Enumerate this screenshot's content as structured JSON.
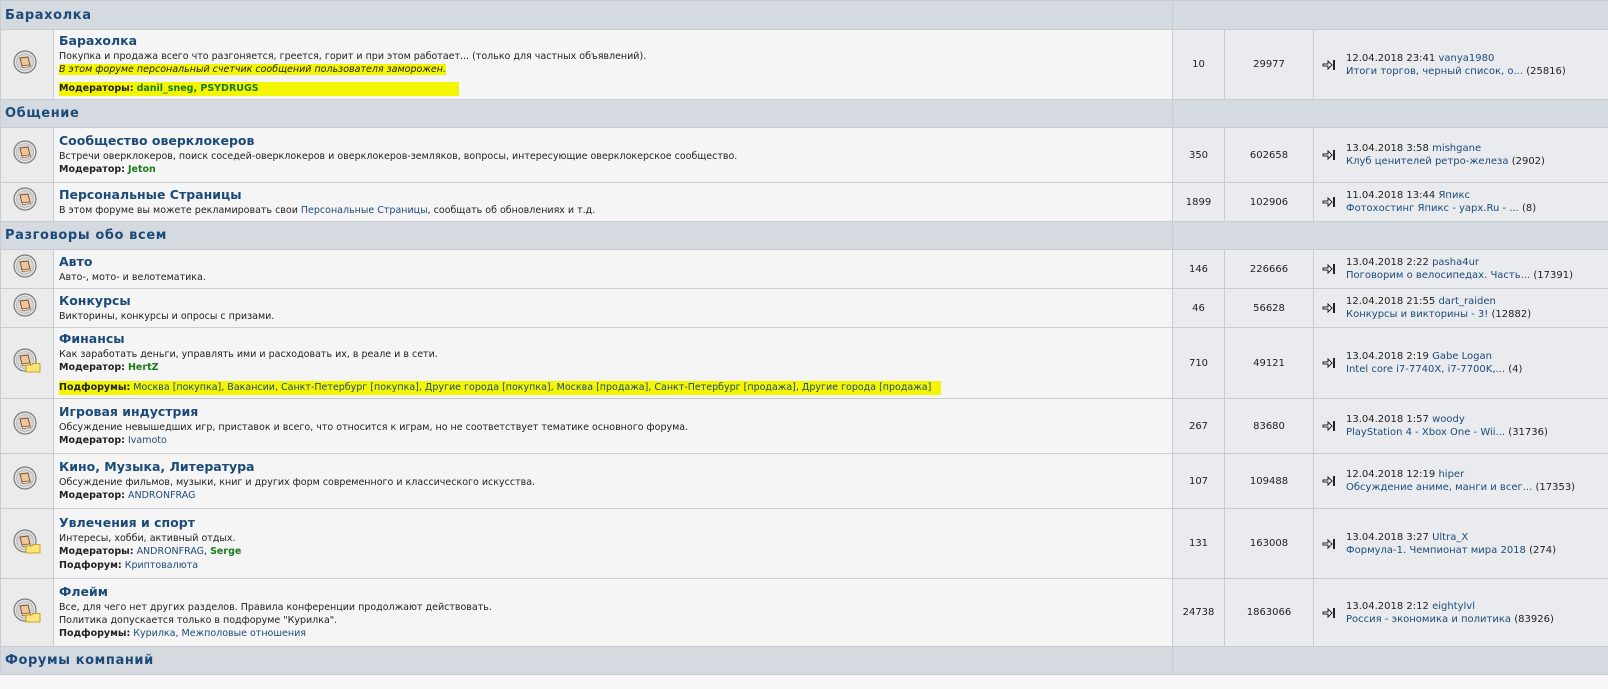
{
  "categories": [
    {
      "title": "Барахолка",
      "forums": [
        {
          "name": "Барахолка",
          "desc": "Покупка и продажа всего что разгоняется, греется, горит и при этом работает... (только для частных объявлений).",
          "note": "В этом форуме персональный счетчик сообщений пользователя заморожен.",
          "moderators_label": "Модераторы:",
          "moderators": "danil_sneg, PSYDRUGS",
          "topics": "10",
          "posts": "29977",
          "last_date": "12.04.2018 23:41",
          "last_user": "vanya1980",
          "last_title": "Итоги торгов, черный список, о...",
          "last_count": "(25816)"
        }
      ]
    },
    {
      "title": "Общение",
      "forums": [
        {
          "name": "Сообщество оверклокеров",
          "desc": "Встречи оверклокеров, поиск соседей-оверклокеров и оверклокеров-земляков, вопросы, интересующие оверклокерское сообщество.",
          "moderators_label": "Модератор:",
          "moderators": "Jeton",
          "topics": "350",
          "posts": "602658",
          "last_date": "13.04.2018 3:58",
          "last_user": "mishgane",
          "last_title": "Клуб ценителей ретро-железа",
          "last_count": "(2902)"
        },
        {
          "name": "Персональные Страницы",
          "desc_a": "В этом форуме вы можете рекламировать свои ",
          "desc_link": "Персональные Страницы",
          "desc_b": ", сообщать об обновлениях и т.д.",
          "topics": "1899",
          "posts": "102906",
          "last_date": "11.04.2018 13:44",
          "last_user": "Япикс",
          "last_title": "Фотохостинг Япикс - yapx.Ru - ...",
          "last_count": "(8)"
        }
      ]
    },
    {
      "title": "Разговоры обо всем",
      "forums": [
        {
          "name": "Авто",
          "desc": "Авто-, мото- и велотематика.",
          "topics": "146",
          "posts": "226666",
          "last_date": "13.04.2018 2:22",
          "last_user": "pasha4ur",
          "last_title": "Поговорим о велосипедах. Часть...",
          "last_count": "(17391)"
        },
        {
          "name": "Конкурсы",
          "desc": "Викторины, конкурсы и опросы с призами.",
          "topics": "46",
          "posts": "56628",
          "last_date": "12.04.2018 21:55",
          "last_user": "dart_raiden",
          "last_title": "Конкурсы и викторины - 3!",
          "last_count": "(12882)"
        },
        {
          "name": "Финансы",
          "desc": "Как заработать деньги, управлять ими и расходовать их, в реале и в сети.",
          "moderators_label": "Модератор:",
          "moderators": "HertZ",
          "subforums_label": "Подфорумы:",
          "subforums": "Москва [покупка], Вакансии, Санкт-Петербург [покупка], Другие города [покупка], Москва [продажа], Санкт-Петербург [продажа], Другие города [продажа]",
          "topics": "710",
          "posts": "49121",
          "last_date": "13.04.2018 2:19",
          "last_user": "Gabe Logan",
          "last_title": "Intel core i7-7740X, i7-7700K,...",
          "last_count": "(4)"
        },
        {
          "name": "Игровая индустрия",
          "desc": "Обсуждение невышедших игр, приставок и всего, что относится к играм, но не соответствует тематике основного форума.",
          "moderators_label": "Модератор:",
          "moderators": "Ivamoto",
          "topics": "267",
          "posts": "83680",
          "last_date": "13.04.2018 1:57",
          "last_user": "woody",
          "last_title": "PlayStation 4 - Xbox One - Wii...",
          "last_count": "(31736)"
        },
        {
          "name": "Кино, Музыка, Литература",
          "desc": "Обсуждение фильмов, музыки, книг и других форм современного и классического искусства.",
          "moderators_label": "Модератор:",
          "moderators": "ANDRONFRAG",
          "topics": "107",
          "posts": "109488",
          "last_date": "12.04.2018 12:19",
          "last_user": "hiper",
          "last_title": "Обсуждение аниме, манги и всег...",
          "last_count": "(17353)"
        },
        {
          "name": "Увлечения и спорт",
          "desc": "Интересы, хобби, активный отдых.",
          "moderators_label": "Модераторы:",
          "moderators_a": "ANDRONFRAG",
          "moderators_sep": ", ",
          "moderators_b": "Serge",
          "subforums_label": "Подфорум:",
          "subforums": "Криптовалюта",
          "topics": "131",
          "posts": "163008",
          "last_date": "13.04.2018 3:27",
          "last_user": "Ultra_X",
          "last_title": "Формула-1. Чемпионат мира 2018",
          "last_count": "(274)"
        },
        {
          "name": "Флейм",
          "desc": "Все, для чего нет других разделов. Правила конференции продолжают действовать.",
          "desc2": "Политика допускается только в подфоруме \"Курилка\".",
          "subforums_label": "Подфорумы:",
          "subforums": "Курилка, Межполовые отношения",
          "topics": "24738",
          "posts": "1863066",
          "last_date": "13.04.2018 2:12",
          "last_user": "eightylvl",
          "last_title": "Россия - экономика и политика",
          "last_count": "(83926)"
        }
      ]
    },
    {
      "title": "Форумы компаний"
    }
  ],
  "colors": {
    "category_bg": "#d5d9e0",
    "title": "#1c4b79",
    "moderator_green": "#1a7a1a",
    "highlight": "#f4f500"
  },
  "icons": {
    "forum": "forum-book-icon",
    "forum_sub": "forum-book-folder-icon",
    "last_post": "last-post-arrow-icon"
  }
}
